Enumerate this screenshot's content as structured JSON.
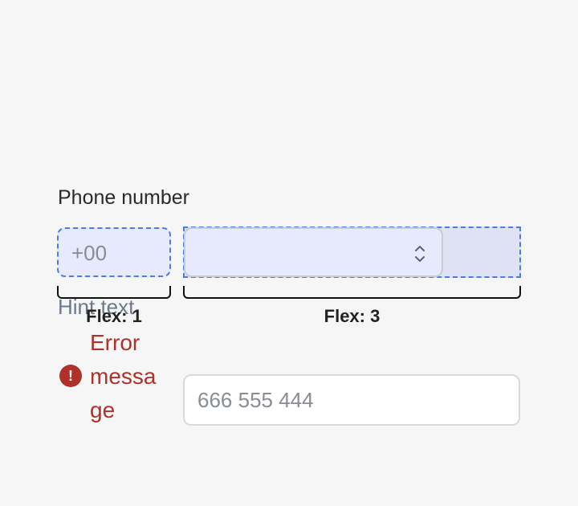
{
  "field": {
    "label": "Phone number"
  },
  "country_code": {
    "placeholder": "+00"
  },
  "guides": {
    "left_label": "Flex: 1",
    "right_label": "Flex: 3"
  },
  "hint": {
    "text": "Hint text"
  },
  "error": {
    "message": "Error message",
    "icon": "exclamation-circle-icon",
    "color": "#b0302a"
  },
  "number": {
    "placeholder": "666 555 444"
  },
  "colors": {
    "outline": "#4a7be6",
    "highlight": "#e7eafc"
  }
}
